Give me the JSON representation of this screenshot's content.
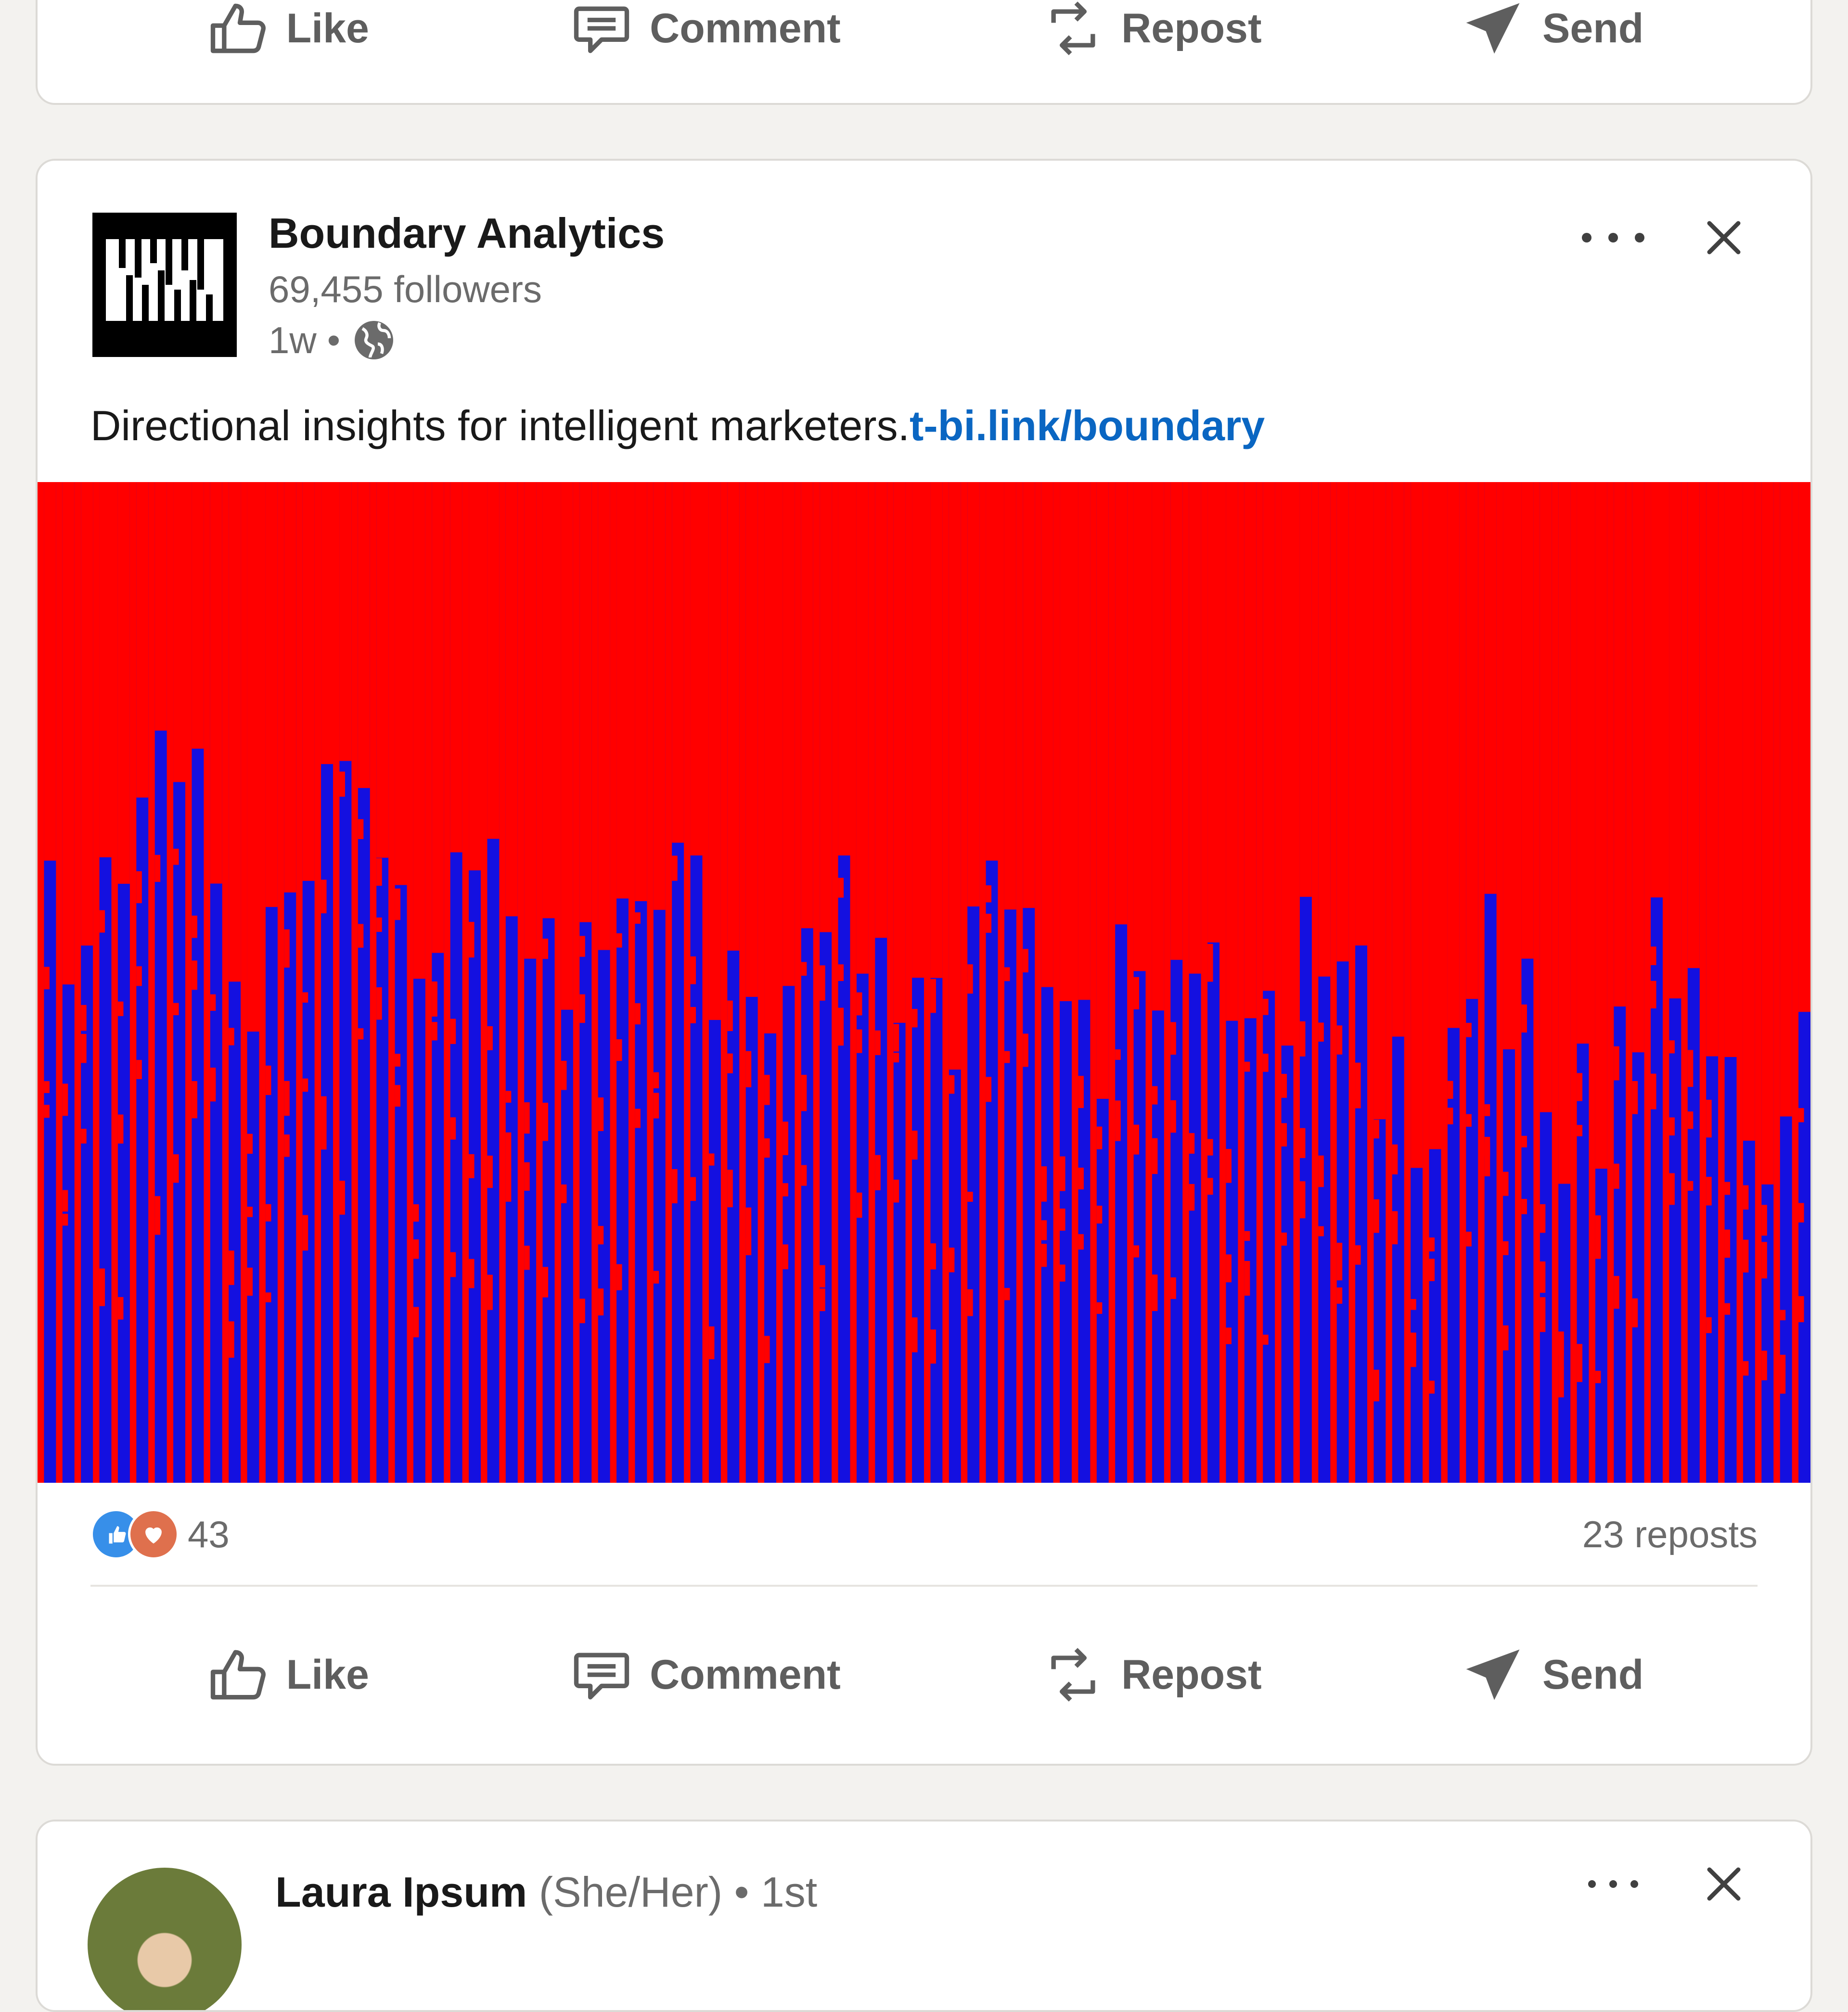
{
  "action_bar": {
    "like": "Like",
    "comment": "Comment",
    "repost": "Repost",
    "send": "Send"
  },
  "post": {
    "author": "Boundary Analytics",
    "followers": "69,455 followers",
    "age": "1w",
    "dot": "•",
    "text": "Directional insights for intelligent marketers.",
    "link": "t-bi.link/boundary",
    "reaction_count": "43",
    "reposts": "23 reposts"
  },
  "next_post": {
    "author": "Laura Ipsum",
    "pronouns": "(She/Her)",
    "connection": "• 1st"
  },
  "colors": {
    "image_red": "#ff0000",
    "image_blue": "#1410e0",
    "link": "#0a66c2"
  }
}
